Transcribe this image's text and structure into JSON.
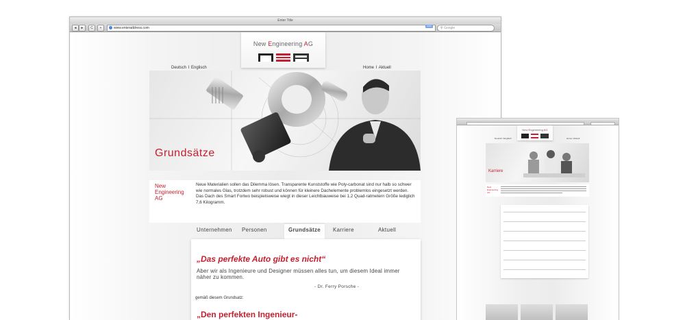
{
  "main_window": {
    "title": "Enter Title",
    "url": "www.enteraddress.com",
    "rss": "RSS",
    "search_placeholder": "Google",
    "nav_buttons": [
      "◄",
      "►",
      "C",
      "+"
    ]
  },
  "site": {
    "logo_prefix_1": "New ",
    "logo_e": "E",
    "logo_mid": "ngineering ",
    "logo_a": "A",
    "logo_end": "G",
    "lang_de": "Deutsch",
    "lang_sep": "I",
    "lang_en": "Englisch",
    "nav_home": "Home",
    "nav_sep": "I",
    "nav_news": "Aktuell",
    "hero_title": "Grundsätze",
    "intro_label": "New Engineering AG",
    "intro_text": "Neue Materialien sollen das Dilemma lösen. Transparente Kunststoffe wie Poly-carbonat sind nur halb so schwer wie normales Glas, trotzdem sehr robust und können für kleinere Dachelemente problemlos eingesetzt werden. Das Dach des Smart Fortwo beispielsweise wiegt in dieser Leichtbauweise bei 1,2 Quad-ratmetern Größe lediglich 7,6 Kilogramm.",
    "tabs": [
      "Unternehmen",
      "Personen",
      "Grundsätze",
      "Karriere",
      "Aktuell"
    ],
    "active_tab": "Grundsätze",
    "quote1": "„Das perfekte Auto gibt es nicht“",
    "quote1_text": "Aber wir als Ingenieure und Designer müssen alles tun, um diesem Ideal immer näher zu kommen.",
    "quote1_author": "- Dr. Ferry Porsche -",
    "note": "gemäß diesem Grundsatz:",
    "quote2": "„Den perfekten Ingenieur-"
  },
  "second_window": {
    "hero_title": "Karriere",
    "intro_label": "New Engineering AG",
    "lang": "Deutsch I Englisch",
    "nav": "Home I Aktuell"
  },
  "colors": {
    "brand_red": "#c4202f",
    "text": "#333333"
  }
}
